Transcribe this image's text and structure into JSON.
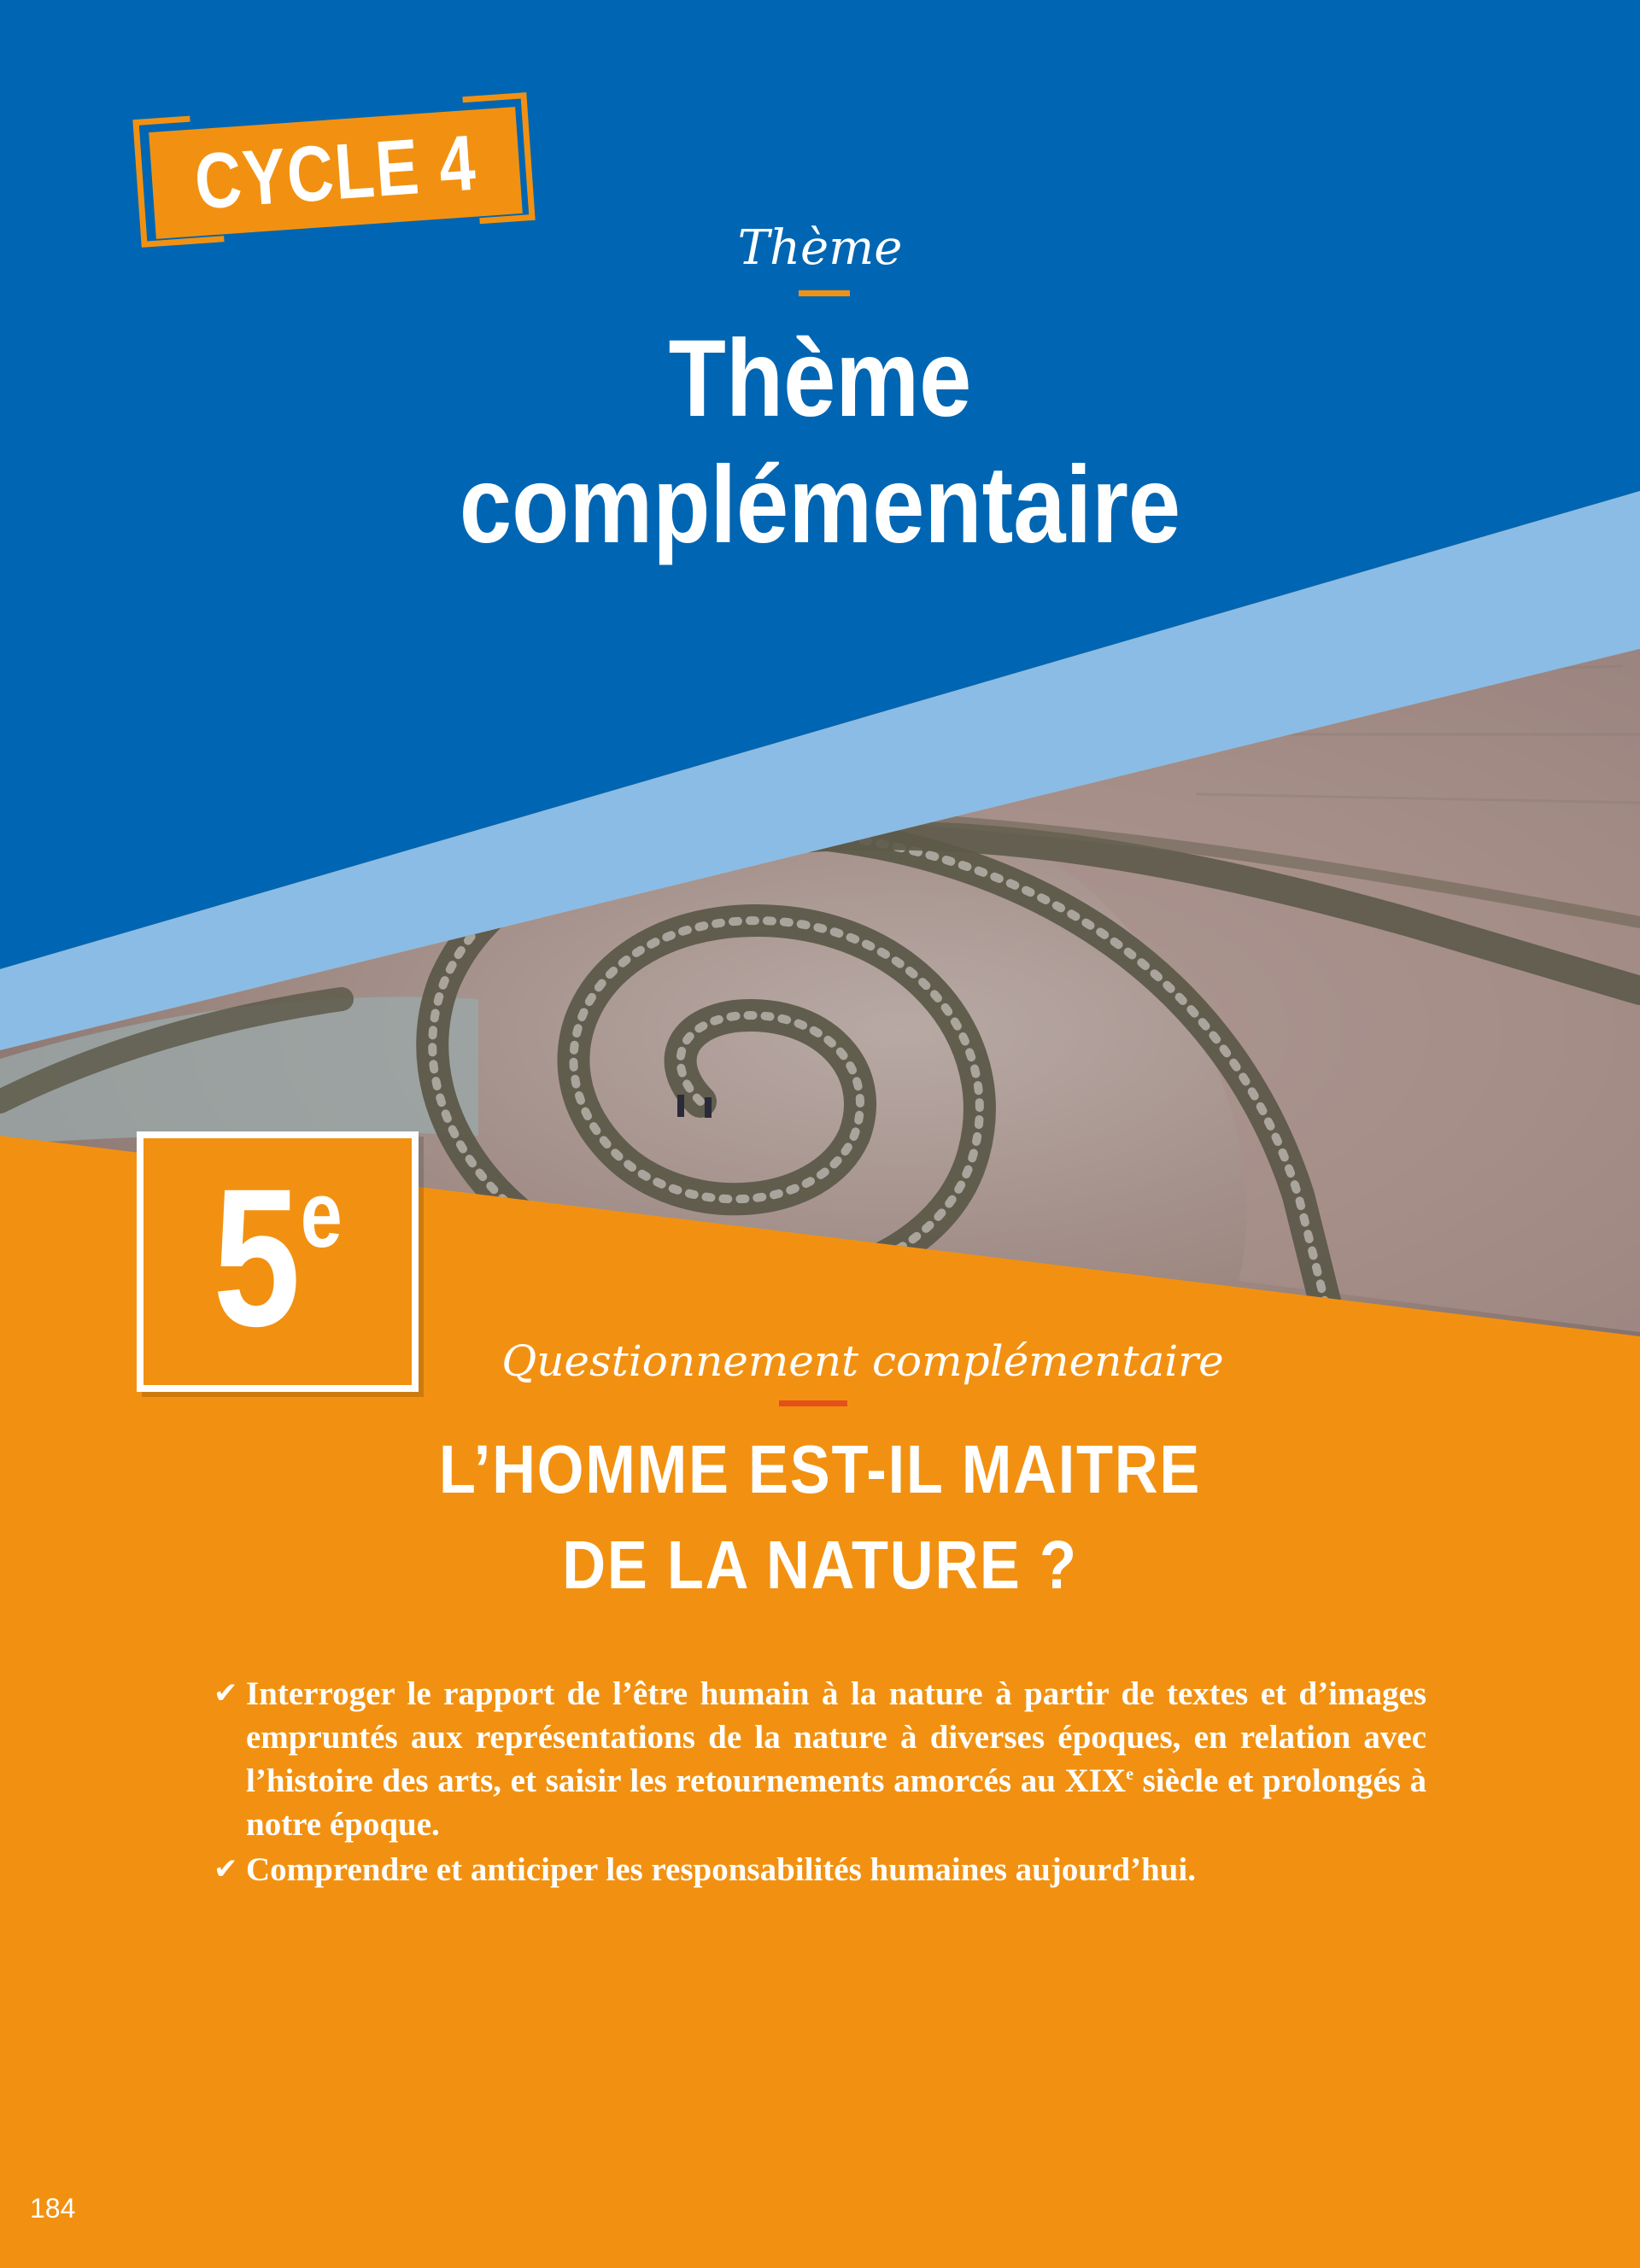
{
  "header": {
    "cycle_label": "CYCLE 4",
    "theme_script": "Thème",
    "theme_title_line1": "Thème",
    "theme_title_line2": "complémentaire"
  },
  "grade": {
    "number": "5",
    "suffix": "e"
  },
  "question": {
    "script": "Questionnement complémentaire",
    "title_line1": "L’HOMME EST-IL MAITRE",
    "title_line2": "DE LA NATURE ?"
  },
  "objectives": {
    "check_icon": "✔",
    "item1_part1": "Interroger le rapport de l’être humain à la nature à partir de textes et d’images empruntés aux représentations de la nature à diverses époques, en relation avec l’histoire des arts, et saisir les retournements amorcés au XIX",
    "item1_sup": "e",
    "item1_part2": " siècle et prolongés à notre époque.",
    "item2": "Comprendre et anticiper les responsabilités humaines aujourd’hui."
  },
  "page_number": "184",
  "colors": {
    "blue": "#0066B3",
    "light_blue": "#8BBCE5",
    "orange": "#F29111",
    "accent_red": "#E4501A"
  }
}
